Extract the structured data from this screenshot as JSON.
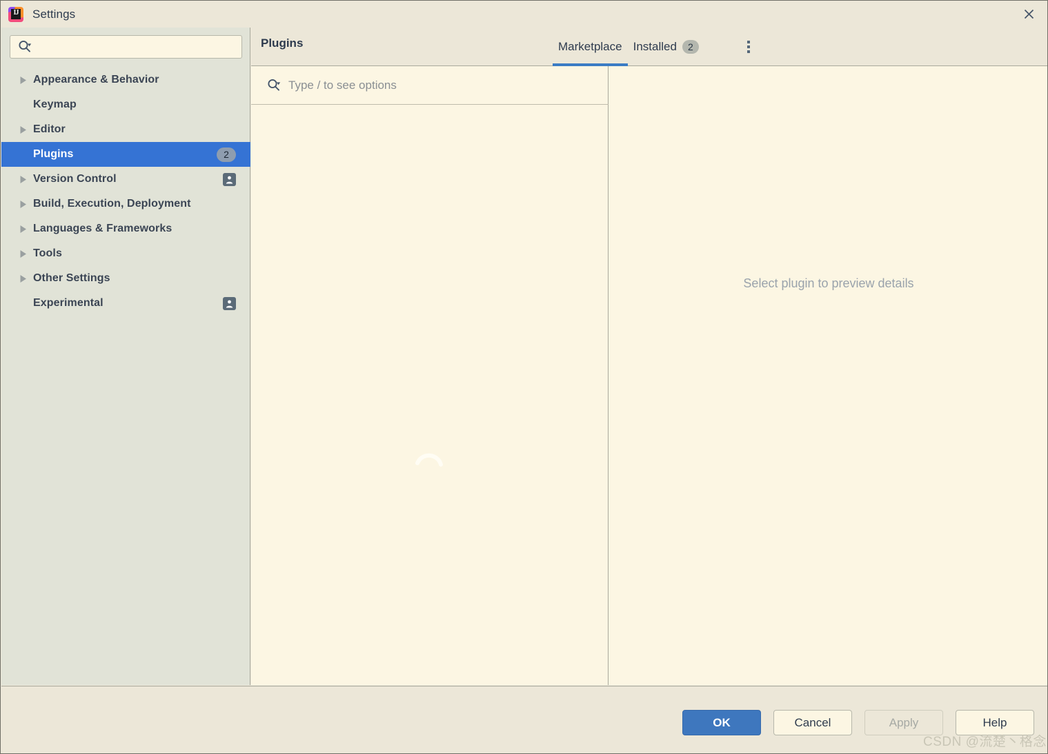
{
  "window": {
    "title": "Settings",
    "logo_glyph": "IJ",
    "close_icon": "close-icon"
  },
  "sidebar": {
    "search": {
      "value": "",
      "placeholder": ""
    },
    "items": [
      {
        "label": "Appearance & Behavior",
        "arrow": true,
        "badge": null,
        "user_icon": false,
        "selected": false
      },
      {
        "label": "Keymap",
        "arrow": false,
        "badge": null,
        "user_icon": false,
        "selected": false
      },
      {
        "label": "Editor",
        "arrow": true,
        "badge": null,
        "user_icon": false,
        "selected": false
      },
      {
        "label": "Plugins",
        "arrow": false,
        "badge": "2",
        "user_icon": false,
        "selected": true
      },
      {
        "label": "Version Control",
        "arrow": true,
        "badge": null,
        "user_icon": true,
        "selected": false
      },
      {
        "label": "Build, Execution, Deployment",
        "arrow": true,
        "badge": null,
        "user_icon": false,
        "selected": false
      },
      {
        "label": "Languages & Frameworks",
        "arrow": true,
        "badge": null,
        "user_icon": false,
        "selected": false
      },
      {
        "label": "Tools",
        "arrow": true,
        "badge": null,
        "user_icon": false,
        "selected": false
      },
      {
        "label": "Other Settings",
        "arrow": true,
        "badge": null,
        "user_icon": false,
        "selected": false
      },
      {
        "label": "Experimental",
        "arrow": false,
        "badge": null,
        "user_icon": true,
        "selected": false
      }
    ]
  },
  "main": {
    "page_title": "Plugins",
    "tabs": [
      {
        "label": "Marketplace",
        "badge": null,
        "active": true
      },
      {
        "label": "Installed",
        "badge": "2",
        "active": false
      }
    ],
    "kebab_icon": "more-vertical-icon",
    "plugin_search": {
      "value": "",
      "placeholder": "Type / to see options"
    },
    "loading": true,
    "preview_placeholder": "Select plugin to preview details"
  },
  "footer": {
    "ok_label": "OK",
    "cancel_label": "Cancel",
    "apply_label": "Apply",
    "help_label": "Help"
  },
  "watermark": "CSDN @流楚丶格念",
  "colors": {
    "accent": "#3573d4",
    "tab_underline": "#3b7cc4",
    "sidebar_bg": "#e1e3d7",
    "panel_bg": "#fcf6e3",
    "chrome_bg": "#ece7d8",
    "ok_button": "#3e77be"
  }
}
